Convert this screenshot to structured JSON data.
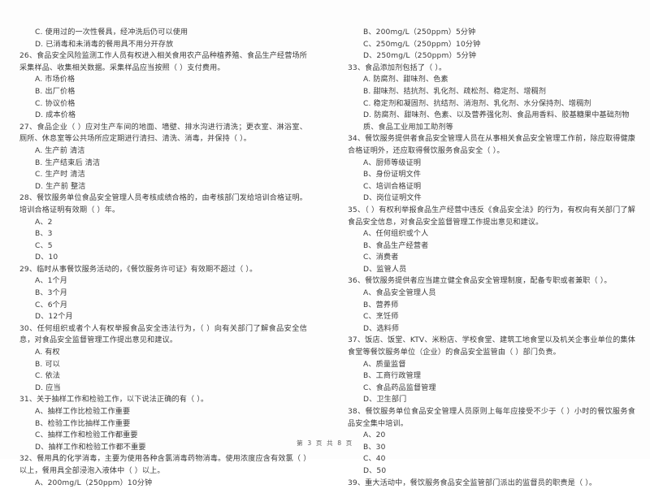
{
  "document": {
    "footer": "第 3 页 共 8 页",
    "page_number": "3",
    "total_pages": "8"
  },
  "left_column": {
    "blocks": [
      {
        "kind": "option",
        "text": "C. 使用过的一次性餐具，经冲洗后仍可以使用"
      },
      {
        "kind": "option",
        "text": "D. 已消毒和未消毒的餐用具不用分开存放"
      },
      {
        "kind": "stem",
        "text": "26、食品安全风险监测工作人员有权进入相关食用农产品种植养殖、食品生产经营场所采集样品、收集相关数据。采集样品应当按照（      ）支付费用。"
      },
      {
        "kind": "option",
        "text": "A. 市场价格"
      },
      {
        "kind": "option",
        "text": "B. 出厂价格"
      },
      {
        "kind": "option",
        "text": "C. 协议价格"
      },
      {
        "kind": "option",
        "text": "D. 成本价格"
      },
      {
        "kind": "stem",
        "text": "27、食品企业（      ）应对生产车间的地面、墙壁、排水沟进行清洗；更衣室、淋浴室、厕所、休息室等公共场所应定期进行清扫、清洗、消毒，并保持（      ）。"
      },
      {
        "kind": "option",
        "text": "A. 生产前  清洁"
      },
      {
        "kind": "option",
        "text": "B. 生产结束后  清洁"
      },
      {
        "kind": "option",
        "text": "C. 生产时  清洁"
      },
      {
        "kind": "option",
        "text": "D. 生产前  整洁"
      },
      {
        "kind": "stem",
        "text": "28、餐饮服务单位食品安全管理人员考核成绩合格的，由考核部门发给培训合格证明。培训合格证明有效期（      ）年。"
      },
      {
        "kind": "option",
        "text": "A、2"
      },
      {
        "kind": "option",
        "text": "B、3"
      },
      {
        "kind": "option",
        "text": "C、5"
      },
      {
        "kind": "option",
        "text": "D、10"
      },
      {
        "kind": "stem",
        "text": "29、临时从事餐饮服务活动的，《餐饮服务许可证》有效期不超过（      ）。"
      },
      {
        "kind": "option",
        "text": "A、1个月"
      },
      {
        "kind": "option",
        "text": "B、3个月"
      },
      {
        "kind": "option",
        "text": "C、6个月"
      },
      {
        "kind": "option",
        "text": "D、12个月"
      },
      {
        "kind": "stem",
        "text": "30、任何组织或者个人有权举报食品安全违法行为，（      ）向有关部门了解食品安全信息，对食品安全监督管理工作提出意见和建议。"
      },
      {
        "kind": "option",
        "text": "A. 有权"
      },
      {
        "kind": "option",
        "text": "B. 可以"
      },
      {
        "kind": "option",
        "text": "C. 依法"
      },
      {
        "kind": "option",
        "text": "D. 应当"
      },
      {
        "kind": "stem",
        "text": "31、关于抽样工作和检验工作，以下说法正确的有（      ）。"
      },
      {
        "kind": "option",
        "text": "A、抽样工作比检验工作重要"
      },
      {
        "kind": "option",
        "text": "B、检验工作比抽样工作重要"
      },
      {
        "kind": "option",
        "text": "C、抽样工作和检验工作都重要"
      },
      {
        "kind": "option",
        "text": "D、抽样工作和检验工作都不重要"
      },
      {
        "kind": "stem",
        "text": "32、餐用具的化学消毒，主要为使用各种含氯消毒药物消毒。使用浓度应含有效氯（      ）以上，餐用具全部浸泡入液体中（      ）以上。"
      },
      {
        "kind": "option",
        "text": "A、200mg/L（250ppm）10分钟"
      }
    ]
  },
  "right_column": {
    "blocks": [
      {
        "kind": "option",
        "text": "B、200mg/L（250ppm）5分钟"
      },
      {
        "kind": "option",
        "text": "C、250mg/L（250ppm）10分钟"
      },
      {
        "kind": "option",
        "text": "D、250mg/L（250ppm）5分钟"
      },
      {
        "kind": "stem",
        "text": "33、食品添加剂包括了（      ）。"
      },
      {
        "kind": "option",
        "text": "A. 防腐剂、甜味剂、色素"
      },
      {
        "kind": "option",
        "text": "B. 甜味剂、拮抗剂、乳化剂、疏松剂、稳定剂、增稠剂"
      },
      {
        "kind": "option",
        "text": "C. 稳定剂和凝固剂、抗结剂、消泡剂、乳化剂、水分保持剂、增稠剂"
      },
      {
        "kind": "option",
        "wrap": true,
        "text": "D. 防腐剂、甜味剂、色素、以及营养强化剂、食品用香料、胶基糖果中基础剂物质、食品工业用加工助剂等"
      },
      {
        "kind": "stem",
        "text": "34、餐饮服务提供者食品安全管理人员在从事相关食品安全管理工作前，除应取得健康合格证明外，还应取得餐饮服务食品安全（      ）。"
      },
      {
        "kind": "option",
        "text": "A、厨师等级证明"
      },
      {
        "kind": "option",
        "text": "B、身份证明文件"
      },
      {
        "kind": "option",
        "text": "C、培训合格证明"
      },
      {
        "kind": "option",
        "text": "D、岗位证明文件"
      },
      {
        "kind": "stem",
        "text": "35、（      ）有权利举报食品生产经营中违反《食品安全法》的行为，有权向有关部门了解食品安全信息，对食品安全监督管理工作提出意见和建议。"
      },
      {
        "kind": "option",
        "text": "A、任何组织或个人"
      },
      {
        "kind": "option",
        "text": "B、食品生产经营者"
      },
      {
        "kind": "option",
        "text": "C、消费者"
      },
      {
        "kind": "option",
        "text": "D、监管人员"
      },
      {
        "kind": "stem",
        "text": "36、餐饮服务提供者应当建立健全食品安全管理制度，配备专职或者兼职（      ）。"
      },
      {
        "kind": "option",
        "text": "A、食品安全管理人员"
      },
      {
        "kind": "option",
        "text": "B、营养师"
      },
      {
        "kind": "option",
        "text": "C、烹饪师"
      },
      {
        "kind": "option",
        "text": "D、选料师"
      },
      {
        "kind": "stem",
        "text": "37、饭店、饭堂、KTV、米粉店、学校食堂、建筑工地食堂以及机关企事业单位的集体食堂等餐饮服务单位（企业）的食品安全监管由（      ）部门负责。"
      },
      {
        "kind": "option",
        "text": "A、质量监督"
      },
      {
        "kind": "option",
        "text": "B、工商行政管理"
      },
      {
        "kind": "option",
        "text": "C、食品药品监督管理"
      },
      {
        "kind": "option",
        "text": "D、卫生部门"
      },
      {
        "kind": "stem",
        "text": "38、餐饮服务单位食品安全管理人员原则上每年应接受不少于（      ）小时的餐饮服务食品安全集中培训。"
      },
      {
        "kind": "option",
        "text": "A、20"
      },
      {
        "kind": "option",
        "text": "B、30"
      },
      {
        "kind": "option",
        "text": "C、40"
      },
      {
        "kind": "option",
        "text": "D、50"
      },
      {
        "kind": "stem",
        "text": "39、重大活动中，餐饮服务食品安全监管部门派出的监督员的职责是（      ）。"
      }
    ]
  }
}
